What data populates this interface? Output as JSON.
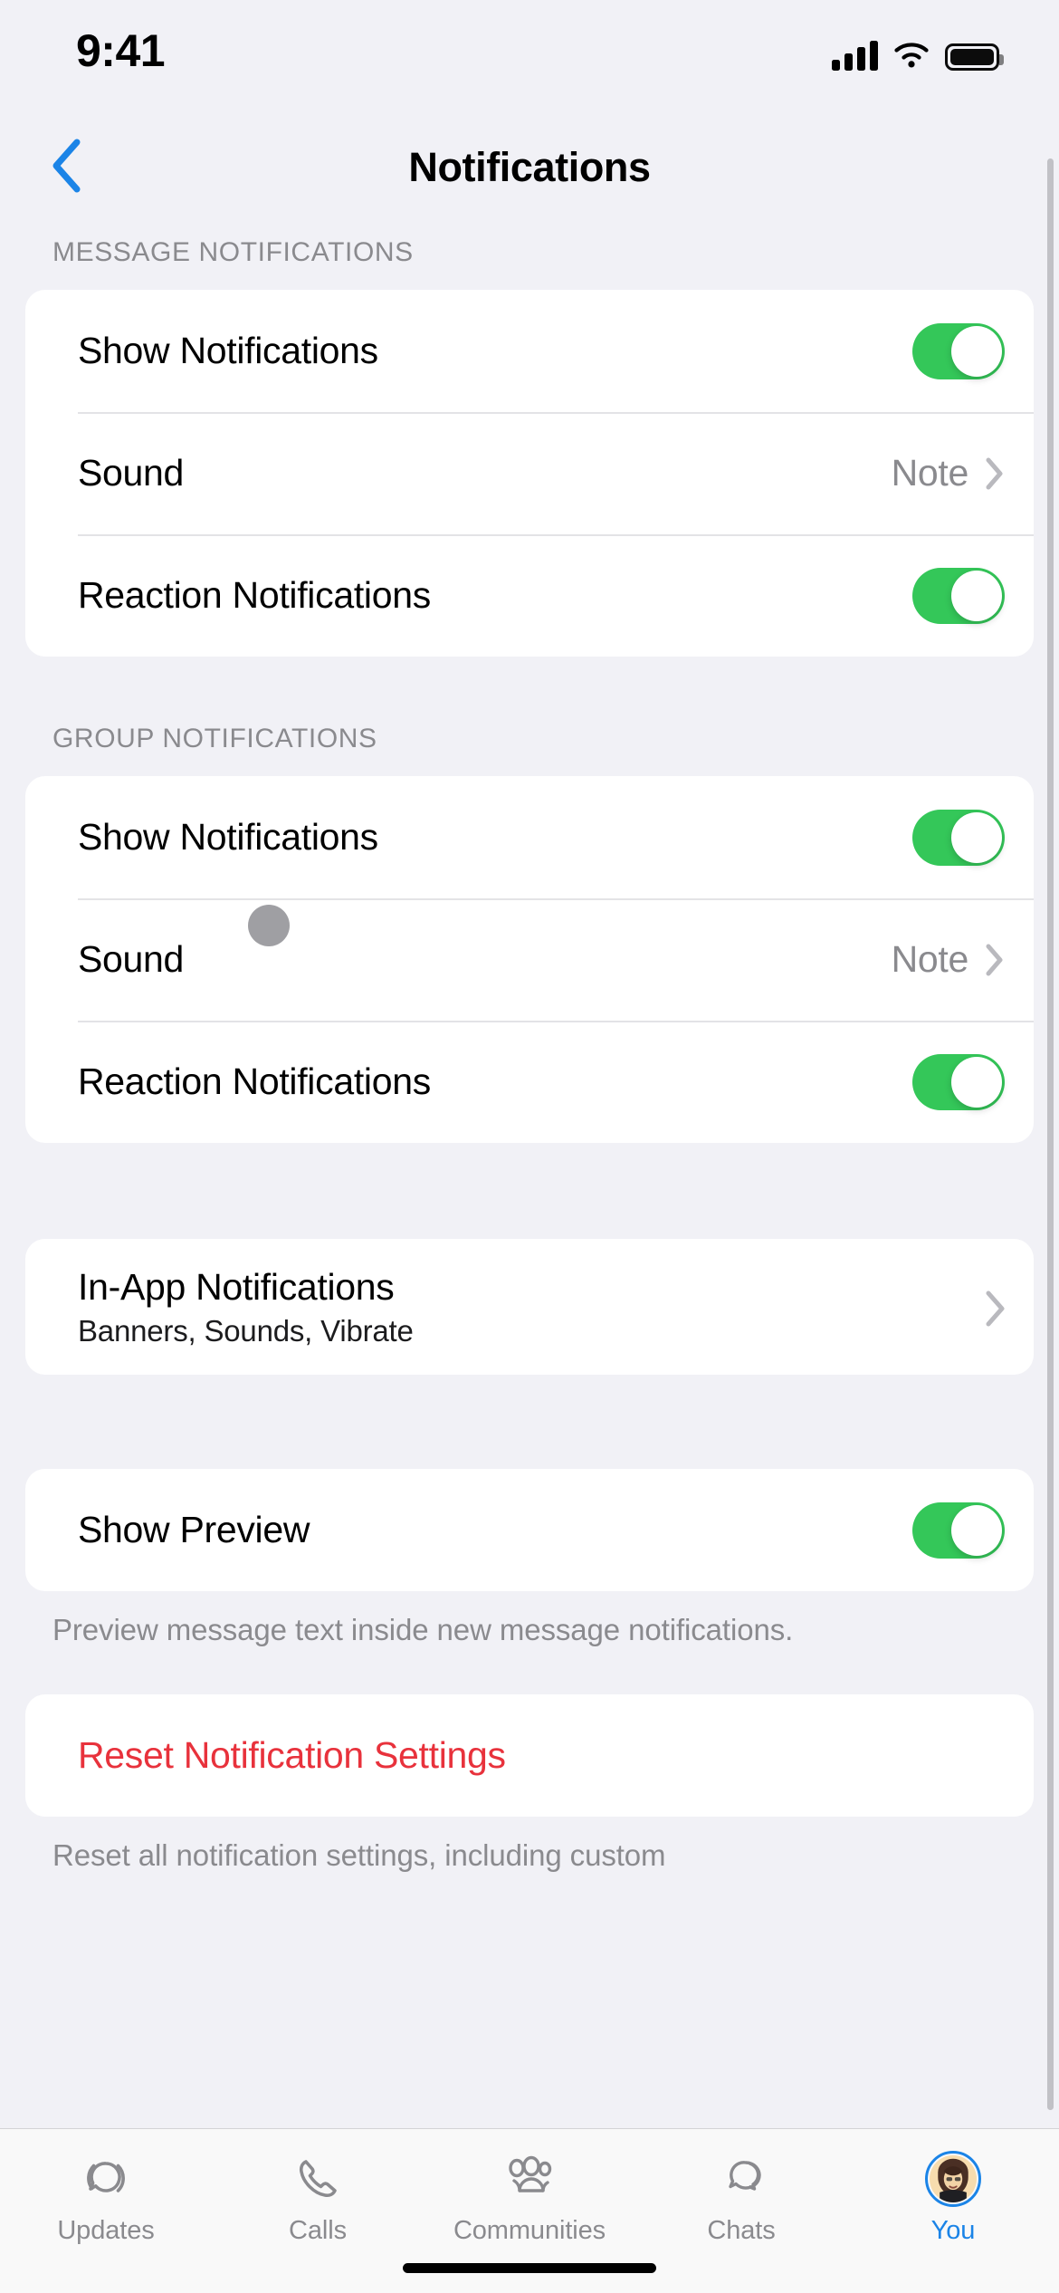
{
  "status_bar": {
    "time": "9:41",
    "signal_icon": "cellular-signal-icon",
    "wifi_icon": "wifi-icon",
    "battery_icon": "battery-full-icon"
  },
  "nav": {
    "back_icon": "chevron-left-icon",
    "title": "Notifications"
  },
  "sections": [
    {
      "header": "MESSAGE NOTIFICATIONS",
      "rows": [
        {
          "label": "Show Notifications",
          "type": "toggle",
          "value": "on"
        },
        {
          "label": "Sound",
          "type": "disclosure",
          "value": "Note"
        },
        {
          "label": "Reaction Notifications",
          "type": "toggle",
          "value": "on"
        }
      ]
    },
    {
      "header": "GROUP NOTIFICATIONS",
      "rows": [
        {
          "label": "Show Notifications",
          "type": "toggle",
          "value": "on"
        },
        {
          "label": "Sound",
          "type": "disclosure",
          "value": "Note"
        },
        {
          "label": "Reaction Notifications",
          "type": "toggle",
          "value": "on"
        }
      ]
    }
  ],
  "in_app": {
    "label": "In-App Notifications",
    "sublabel": "Banners, Sounds, Vibrate",
    "chevron_icon": "chevron-right-icon"
  },
  "show_preview": {
    "label": "Show Preview",
    "value": "on",
    "footnote": "Preview message text inside new message notifications."
  },
  "reset": {
    "label": "Reset Notification Settings",
    "footnote": "Reset all notification settings, including custom"
  },
  "colors": {
    "toggle_on": "#34c759",
    "tint_blue": "#1b84e7",
    "destructive_red": "#e8323c",
    "secondary_text": "#8a8a8e",
    "page_background": "#f1f1f6",
    "card_background": "#ffffff"
  },
  "tabs": [
    {
      "label": "Updates",
      "icon": "updates-status-icon",
      "active": false
    },
    {
      "label": "Calls",
      "icon": "phone-icon",
      "active": false
    },
    {
      "label": "Communities",
      "icon": "people-group-icon",
      "active": false
    },
    {
      "label": "Chats",
      "icon": "chat-bubbles-icon",
      "active": false
    },
    {
      "label": "You",
      "icon": "profile-avatar-icon",
      "active": true
    }
  ]
}
